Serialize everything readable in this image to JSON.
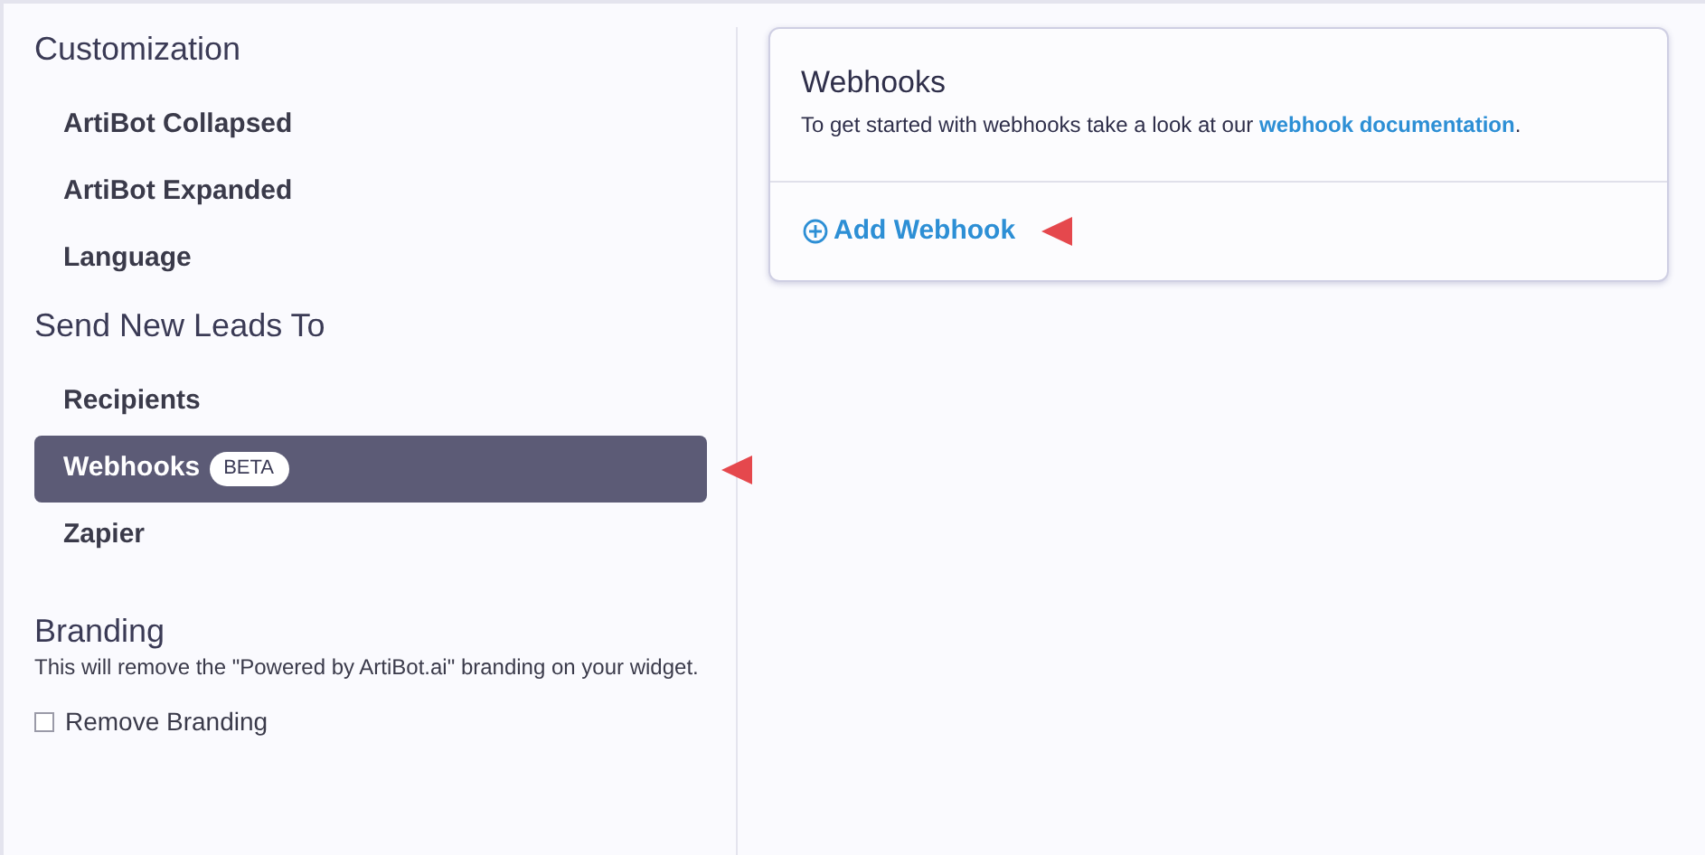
{
  "sidebar": {
    "sections": [
      {
        "title": "Customization",
        "items": [
          {
            "label": "ArtiBot Collapsed",
            "selected": false
          },
          {
            "label": "ArtiBot Expanded",
            "selected": false
          },
          {
            "label": "Language",
            "selected": false
          }
        ]
      },
      {
        "title": "Send New Leads To",
        "items": [
          {
            "label": "Recipients",
            "selected": false
          },
          {
            "label": "Webhooks",
            "selected": true,
            "badge": "BETA"
          },
          {
            "label": "Zapier",
            "selected": false
          }
        ]
      }
    ],
    "branding": {
      "title": "Branding",
      "description": "This will remove the \"Powered by ArtiBot.ai\" branding on your widget.",
      "checkbox": {
        "label": "Remove Branding",
        "checked": false
      }
    }
  },
  "card": {
    "title": "Webhooks",
    "description": "To get started with webhooks take a look at our",
    "link": "webhook documentation",
    "suffix": ".",
    "action": "Add Webhook"
  }
}
